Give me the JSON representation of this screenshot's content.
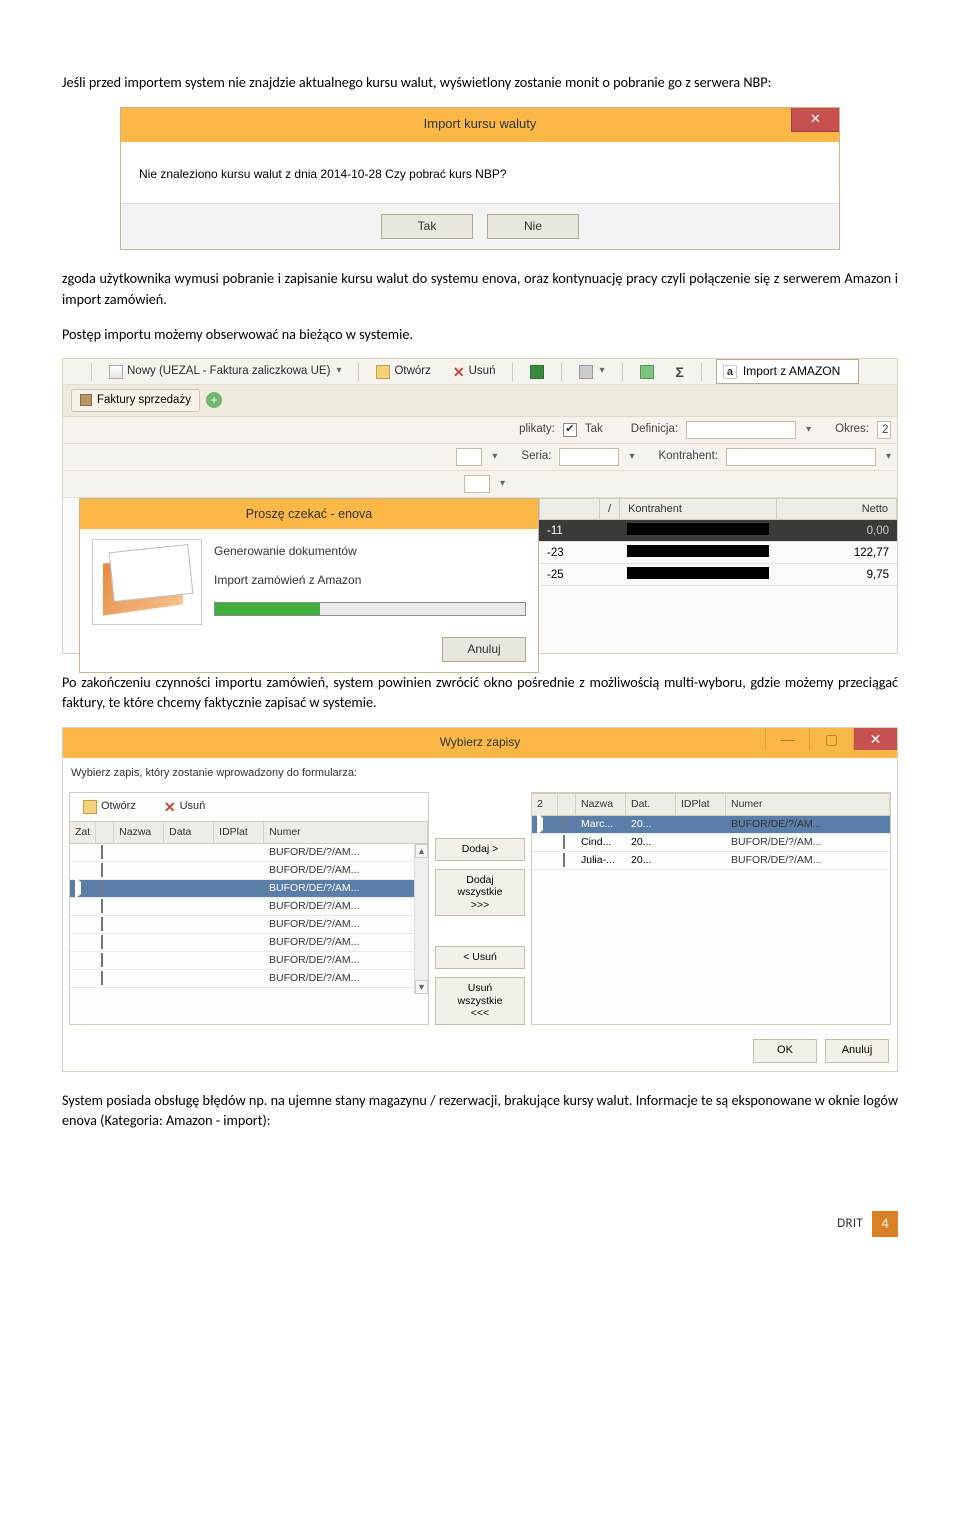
{
  "para1": "Jeśli przed importem system nie znajdzie aktualnego kursu walut, wyświetlony zostanie monit o pobranie go z serwera NBP:",
  "dlg1": {
    "title": "Import kursu waluty",
    "msg": "Nie znaleziono kursu walut z dnia 2014-10-28 Czy pobrać kurs NBP?",
    "yes": "Tak",
    "no": "Nie"
  },
  "para2": "zgoda użytkownika wymusi pobranie i zapisanie kursu walut do systemu enova, oraz kontynuację pracy czyli połączenie się z serwerem Amazon i import zamówień.",
  "para3": "Postęp importu możemy obserwować na bieżąco w systemie.",
  "toolbar": {
    "nowy": "Nowy (UEZAL - Faktura zaliczkowa UE)",
    "otworz": "Otwórz",
    "usun": "Usuń",
    "amazon": "Import z AMAZON",
    "tab": "Faktury sprzedaży",
    "f_duplikaty": "plikaty:",
    "f_dup_val": "Tak",
    "f_def": "Definicja:",
    "f_okres": "Okres:",
    "f_okres_val": "2",
    "f_seria": "Seria:",
    "f_kontr": "Kontrahent:"
  },
  "gridh": {
    "kontr": "Kontrahent",
    "netto": "Netto",
    "slash": "/"
  },
  "gridrows": [
    {
      "d": "-11",
      "netto": "0,00",
      "sel": true
    },
    {
      "d": "-23",
      "netto": "122,77",
      "sel": false
    },
    {
      "d": "-25",
      "netto": "9,75",
      "sel": false
    }
  ],
  "prog": {
    "title": "Proszę czekać - enova",
    "l1": "Generowanie dokumentów",
    "l2": "Import zamówień z Amazon",
    "cancel": "Anuluj",
    "pct": 34
  },
  "para4": "Po zakończeniu czynności importu zamówień, system powinien zwrócić okno pośrednie z możliwością multi-wyboru, gdzie możemy przeciągać faktury, te które chcemy faktycznie zapisać w systemie.",
  "wyb": {
    "title": "Wybierz zapisy",
    "instr": "Wybierz zapis, który zostanie wprowadzony do formularza:",
    "otworz": "Otwórz",
    "usun": "Usuń",
    "h_zat": "Zat",
    "h_nazwa": "Nazwa",
    "h_data": "Data",
    "h_idplat": "IDPlat",
    "h_numer": "Numer",
    "h_2": "2",
    "h_dat": "Dat.",
    "numer_val": "BUFOR/DE/?/AM...",
    "add": "Dodaj >",
    "addall1": "Dodaj",
    "addall2": "wszystkie",
    "addall3": ">>>",
    "rem": "< Usuń",
    "remall1": "Usuń",
    "remall2": "wszystkie",
    "remall3": "<<<",
    "ok": "OK",
    "anuluj": "Anuluj",
    "right": [
      {
        "n": "Marc...",
        "d": "20..."
      },
      {
        "n": "Cind...",
        "d": "20..."
      },
      {
        "n": "Julia-...",
        "d": "20..."
      }
    ]
  },
  "para5": "System posiada obsługę błędów np. na ujemne stany magazynu / rezerwacji, brakujące kursy walut. Informacje te są eksponowane w oknie logów enova (Kategoria: Amazon - import):",
  "footer": {
    "drit": "DRIT",
    "page": "4"
  }
}
